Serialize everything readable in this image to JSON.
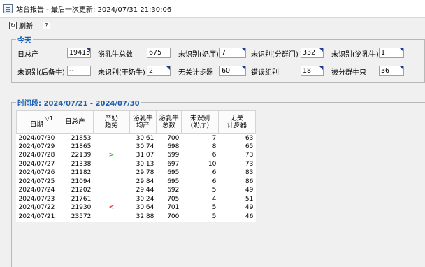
{
  "window": {
    "title": "站台报告 - 最后一次更新: 2024/07/31 21:30:06"
  },
  "toolbar": {
    "refresh_label": "刷新",
    "help_label": ""
  },
  "today": {
    "title": "今天",
    "stats": [
      {
        "label": "日总产",
        "value": "19415",
        "flag": true
      },
      {
        "label": "泌乳牛总数",
        "value": "675",
        "flag": false
      },
      {
        "label": "未识别(奶厅)",
        "value": "7",
        "flag": true
      },
      {
        "label": "未识别(分群门)",
        "value": "332",
        "flag": true
      },
      {
        "label": "未识别(泌乳牛)",
        "value": "1",
        "flag": true
      },
      {
        "label": "未识别(后备牛)",
        "value": "--",
        "flag": false
      },
      {
        "label": "未识别(干奶牛)",
        "value": "2",
        "flag": true
      },
      {
        "label": "无关计步器",
        "value": "60",
        "flag": true
      },
      {
        "label": "错误组别",
        "value": "18",
        "flag": true
      },
      {
        "label": "被分群牛只",
        "value": "36",
        "flag": true
      }
    ]
  },
  "period": {
    "title": "时间段: 2024/07/21 - 2024/07/30",
    "sort_indicator": "▽1",
    "columns": [
      "日期",
      "日总产",
      "产奶\n趋势",
      "泌乳牛\n均产",
      "泌乳牛\n总数",
      "未识别\n(奶厅)",
      "无关\n计步器"
    ],
    "rows": [
      {
        "date": "2024/07/30",
        "total": "21853",
        "trend": "",
        "avg": "30.61",
        "count": "700",
        "unid": "7",
        "ped": "63"
      },
      {
        "date": "2024/07/29",
        "total": "21865",
        "trend": "",
        "avg": "30.74",
        "count": "698",
        "unid": "8",
        "ped": "65"
      },
      {
        "date": "2024/07/28",
        "total": "22139",
        "trend": ">",
        "avg": "31.07",
        "count": "699",
        "unid": "6",
        "ped": "73"
      },
      {
        "date": "2024/07/27",
        "total": "21338",
        "trend": "",
        "avg": "30.13",
        "count": "697",
        "unid": "10",
        "ped": "73"
      },
      {
        "date": "2024/07/26",
        "total": "21182",
        "trend": "",
        "avg": "29.78",
        "count": "695",
        "unid": "6",
        "ped": "83"
      },
      {
        "date": "2024/07/25",
        "total": "21094",
        "trend": "",
        "avg": "29.84",
        "count": "695",
        "unid": "6",
        "ped": "86"
      },
      {
        "date": "2024/07/24",
        "total": "21202",
        "trend": "",
        "avg": "29.44",
        "count": "692",
        "unid": "5",
        "ped": "49"
      },
      {
        "date": "2024/07/23",
        "total": "21761",
        "trend": "",
        "avg": "30.24",
        "count": "705",
        "unid": "4",
        "ped": "51"
      },
      {
        "date": "2024/07/22",
        "total": "21930",
        "trend": "<",
        "avg": "30.64",
        "count": "701",
        "unid": "5",
        "ped": "49"
      },
      {
        "date": "2024/07/21",
        "total": "23572",
        "trend": "",
        "avg": "32.88",
        "count": "700",
        "unid": "5",
        "ped": "46"
      }
    ]
  }
}
